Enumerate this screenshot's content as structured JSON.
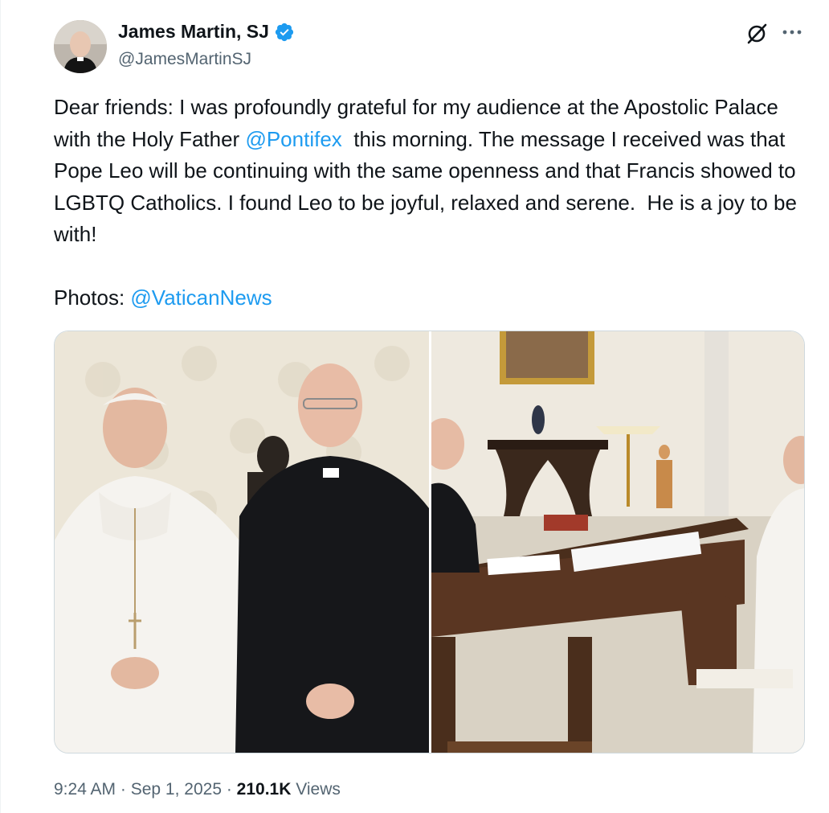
{
  "author": {
    "name": "James Martin, SJ",
    "handle": "@JamesMartinSJ",
    "verified_icon": "verified-badge-icon",
    "verified_color": "#1d9bf0"
  },
  "header_actions": {
    "grok_icon": "grok-icon",
    "more_icon": "more-icon"
  },
  "tweet": {
    "text_before_mention": "Dear friends: I was profoundly grateful for my audience at the Apostolic Palace with the Holy Father ",
    "mention_1": "@Pontifex",
    "text_after_mention": "  this morning. The message I received was that Pope Leo will be continuing with the same openness and that Francis showed to LGBTQ Catholics. I found Leo to be joyful, relaxed and serene.  He is a joy to be with!",
    "photos_label": "Photos: ",
    "mention_2": "@VaticanNews"
  },
  "meta": {
    "time": "9:24 AM",
    "separator": " · ",
    "date": "Sep 1, 2025",
    "views_count": "210.1K",
    "views_label": " Views"
  },
  "colors": {
    "link": "#1d9bf0",
    "secondary_text": "#536471",
    "primary_text": "#0f1419",
    "border": "#cfd9de"
  }
}
